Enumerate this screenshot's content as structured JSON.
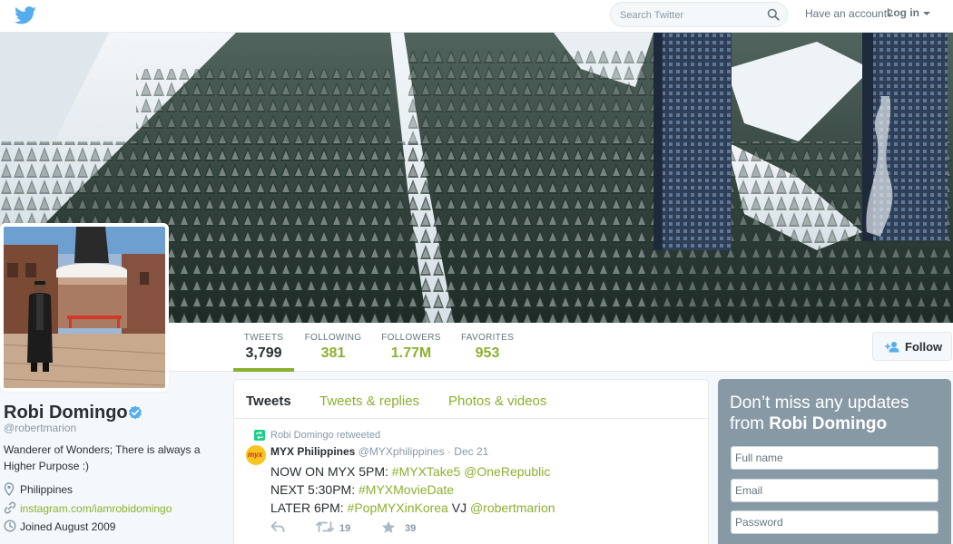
{
  "topbar": {
    "search_placeholder": "Search Twitter",
    "have_account": "Have an account?",
    "login_label": "Log in"
  },
  "nav": {
    "stats": [
      {
        "label": "TWEETS",
        "value": "3,799"
      },
      {
        "label": "FOLLOWING",
        "value": "381"
      },
      {
        "label": "FOLLOWERS",
        "value": "1.77M"
      },
      {
        "label": "FAVORITES",
        "value": "953"
      }
    ],
    "follow_label": "Follow"
  },
  "profile": {
    "name": "Robi Domingo",
    "handle": "@robertmarion",
    "bio": "Wanderer of Wonders; There is always a Higher Purpose :)",
    "location": "Philippines",
    "website": "instagram.com/iamrobidomingo",
    "joined": "Joined August 2009"
  },
  "timeline": {
    "tabs": [
      "Tweets",
      "Tweets & replies",
      "Photos & videos"
    ],
    "tweet": {
      "retweet_notice": "Robi Domingo retweeted",
      "author_name": "MYX Philippines",
      "author_handle": "@MYXphilippines",
      "separator": "·",
      "date": "Dec 21",
      "avatar_text": "myx",
      "line1_text": "NOW ON MYX 5PM: ",
      "line1_tag": "#MYXTake5",
      "line1_mention": "@OneRepublic",
      "line2_text": "NEXT 5:30PM: ",
      "line2_tag": "#MYXMovieDate",
      "line3_text": "LATER 6PM: ",
      "line3_tag": "#PopMYXinKorea",
      "line3_mid": " VJ ",
      "line3_mention": "@robertmarion",
      "retweets": "19",
      "favorites": "39"
    }
  },
  "signup": {
    "heading_prefix": "Don’t miss any updates from ",
    "heading_name": "Robi Domingo",
    "fullname_placeholder": "Full name",
    "email_placeholder": "Email",
    "password_placeholder": "Password"
  },
  "colors": {
    "accent": "#8ab02e",
    "twitter_blue": "#55acee",
    "signup_bg": "#8899a6"
  }
}
